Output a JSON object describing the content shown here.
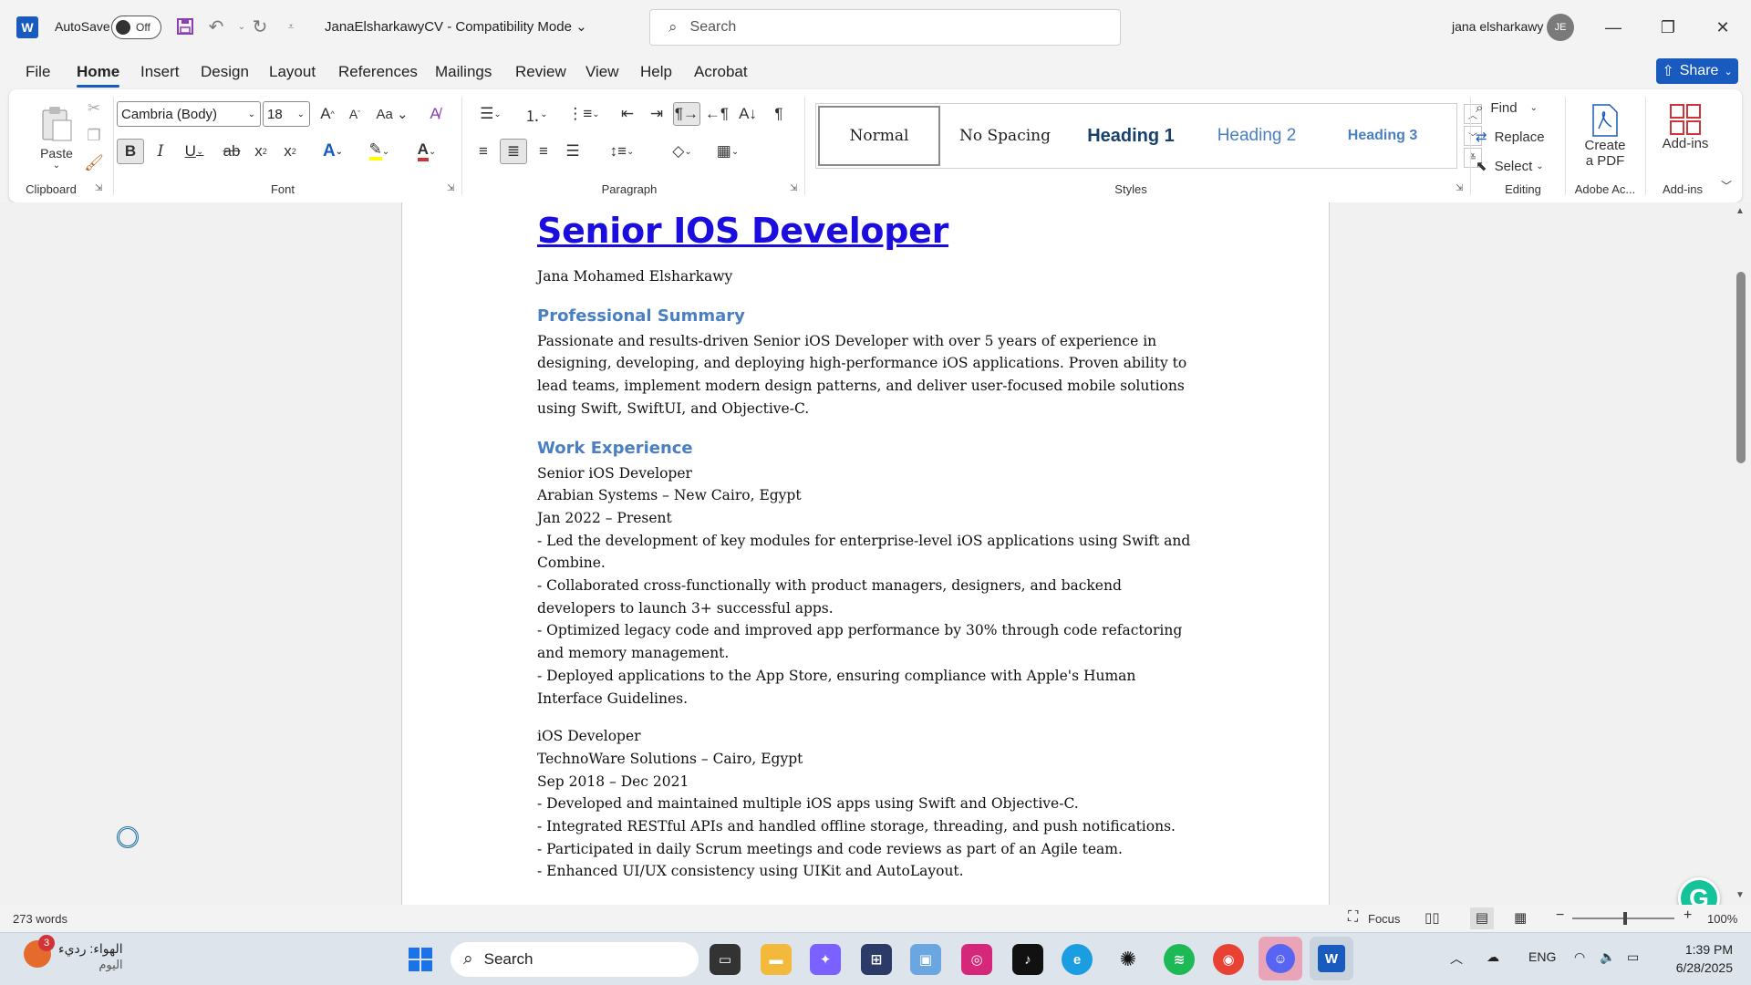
{
  "titlebar": {
    "autosave_label": "AutoSave",
    "autosave_state": "Off",
    "document_title": "JanaElsharkawyCV  -  Compatibility Mode",
    "search_placeholder": "Search",
    "user_name": "jana elsharkawy",
    "user_initials": "JE"
  },
  "menu": {
    "tabs": [
      "File",
      "Home",
      "Insert",
      "Design",
      "Layout",
      "References",
      "Mailings",
      "Review",
      "View",
      "Help",
      "Acrobat"
    ],
    "share_label": "Share"
  },
  "ribbon": {
    "clipboard": {
      "label": "Clipboard",
      "paste": "Paste"
    },
    "font": {
      "label": "Font",
      "font_name": "Cambria (Body)",
      "font_size": "18"
    },
    "paragraph": {
      "label": "Paragraph"
    },
    "styles": {
      "label": "Styles",
      "items": [
        "Normal",
        "No Spacing",
        "Heading 1",
        "Heading 2",
        "Heading 3"
      ]
    },
    "editing": {
      "label": "Editing",
      "find": "Find",
      "replace": "Replace",
      "select": "Select"
    },
    "adobe": {
      "label": "Adobe Ac...",
      "create_pdf_line1": "Create",
      "create_pdf_line2": "a PDF"
    },
    "addins": {
      "label": "Add-ins",
      "button": "Add-ins"
    }
  },
  "document": {
    "title": "Senior IOS Developer",
    "author": "Jana Mohamed Elsharkawy",
    "summary_heading": "Professional Summary",
    "summary_lines": [
      "Passionate and results-driven Senior iOS Developer with over 5 years of experience in",
      "designing, developing, and deploying high-performance iOS applications. Proven ability to",
      "lead teams, implement modern design patterns, and deliver user-focused mobile solutions",
      "using Swift, SwiftUI, and Objective-C."
    ],
    "experience_heading": "Work Experience",
    "job1_lines": [
      "Senior iOS Developer",
      "Arabian Systems – New Cairo, Egypt",
      "Jan 2022 – Present",
      "- Led the development of key modules for enterprise-level iOS applications using Swift and",
      "Combine.",
      "- Collaborated cross-functionally with product managers, designers, and backend",
      "developers to launch 3+ successful apps.",
      "- Optimized legacy code and improved app performance by 30% through code refactoring",
      "and memory management.",
      "- Deployed applications to the App Store, ensuring compliance with Apple's Human",
      "Interface Guidelines."
    ],
    "job2_lines": [
      "iOS Developer",
      "TechnoWare Solutions – Cairo, Egypt",
      "Sep 2018 – Dec 2021",
      "- Developed and maintained multiple iOS apps using Swift and Objective-C.",
      "- Integrated RESTful APIs and handled offline storage, threading, and push notifications.",
      "- Participated in daily Scrum meetings and code reviews as part of an Agile team.",
      "- Enhanced UI/UX consistency using UIKit and AutoLayout."
    ]
  },
  "statusbar": {
    "word_count": "273 words",
    "focus": "Focus",
    "zoom": "100%"
  },
  "taskbar": {
    "weather_text": "الهواء: رديء",
    "weather_sub": "اليوم",
    "weather_badge": "3",
    "search_label": "Search",
    "language": "ENG",
    "time": "1:39 PM",
    "date": "6/28/2025"
  },
  "colors": {
    "accent": "#185abd",
    "title_link": "#1a0dde",
    "heading": "#4a7fc1"
  }
}
